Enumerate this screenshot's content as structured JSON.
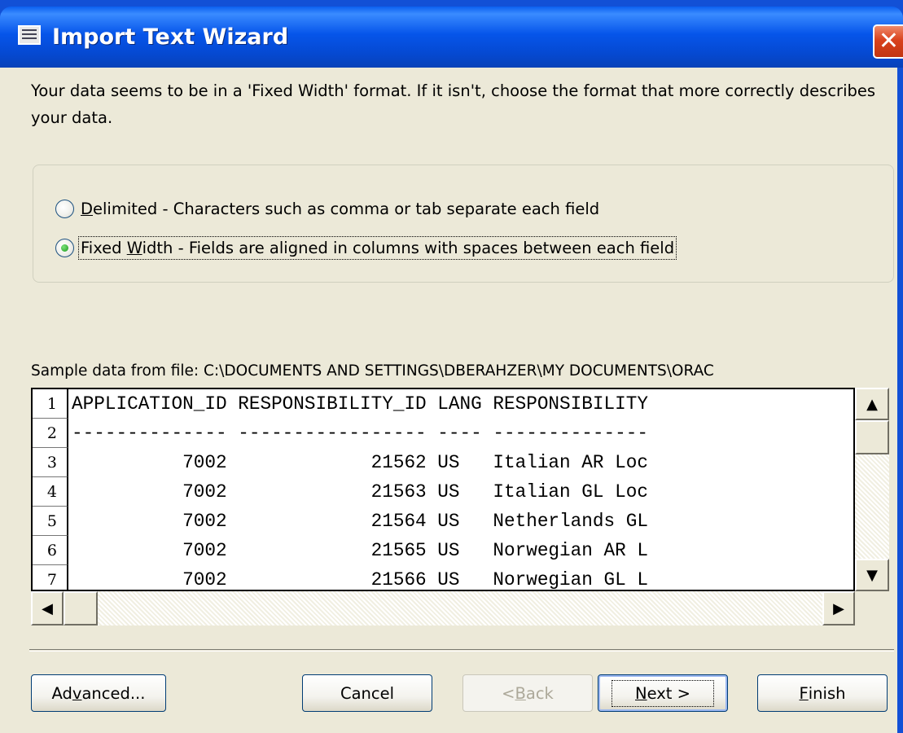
{
  "window": {
    "title": "Import Text Wizard",
    "close_glyph": "✕"
  },
  "description": "Your data seems to be in a 'Fixed Width' format. If it isn't, choose the format that more correctly describes your data.",
  "format_options": [
    {
      "mnemonic": "D",
      "label_rest": "elimited - Characters such as comma or tab separate each field",
      "checked": false
    },
    {
      "pre": "Fixed ",
      "mnemonic": "W",
      "label_rest": "idth - Fields are aligned in columns with spaces between each field",
      "checked": true
    }
  ],
  "sample": {
    "label": "Sample data from file: C:\\DOCUMENTS AND SETTINGS\\DBERAHZER\\MY DOCUMENTS\\ORAC",
    "rows": [
      {
        "num": "1",
        "text": "APPLICATION_ID RESPONSIBILITY_ID LANG RESPONSIBILITY"
      },
      {
        "num": "2",
        "text": "-------------- ----------------- ---- --------------"
      },
      {
        "num": "3",
        "text": "          7002             21562 US   Italian AR Loc"
      },
      {
        "num": "4",
        "text": "          7002             21563 US   Italian GL Loc"
      },
      {
        "num": "5",
        "text": "          7002             21564 US   Netherlands GL"
      },
      {
        "num": "6",
        "text": "          7002             21565 US   Norwegian AR L"
      },
      {
        "num": "7",
        "text": "          7002             21566 US   Norwegian GL L"
      }
    ]
  },
  "scrollbar_glyphs": {
    "up": "▲",
    "down": "▼",
    "left": "◀",
    "right": "▶"
  },
  "buttons": {
    "advanced": {
      "pre": "Ad",
      "mnemonic": "v",
      "post": "anced..."
    },
    "cancel": {
      "label": "Cancel"
    },
    "back": {
      "pre": "< ",
      "mnemonic": "B",
      "post": "ack"
    },
    "next": {
      "pre": "",
      "mnemonic": "N",
      "post": "ext >"
    },
    "finish": {
      "pre": "",
      "mnemonic": "F",
      "post": "inish"
    }
  },
  "colors": {
    "titlebar": "#0655ea",
    "dialog_face": "#ece9d8",
    "radio_dot": "#1c9a1c"
  }
}
